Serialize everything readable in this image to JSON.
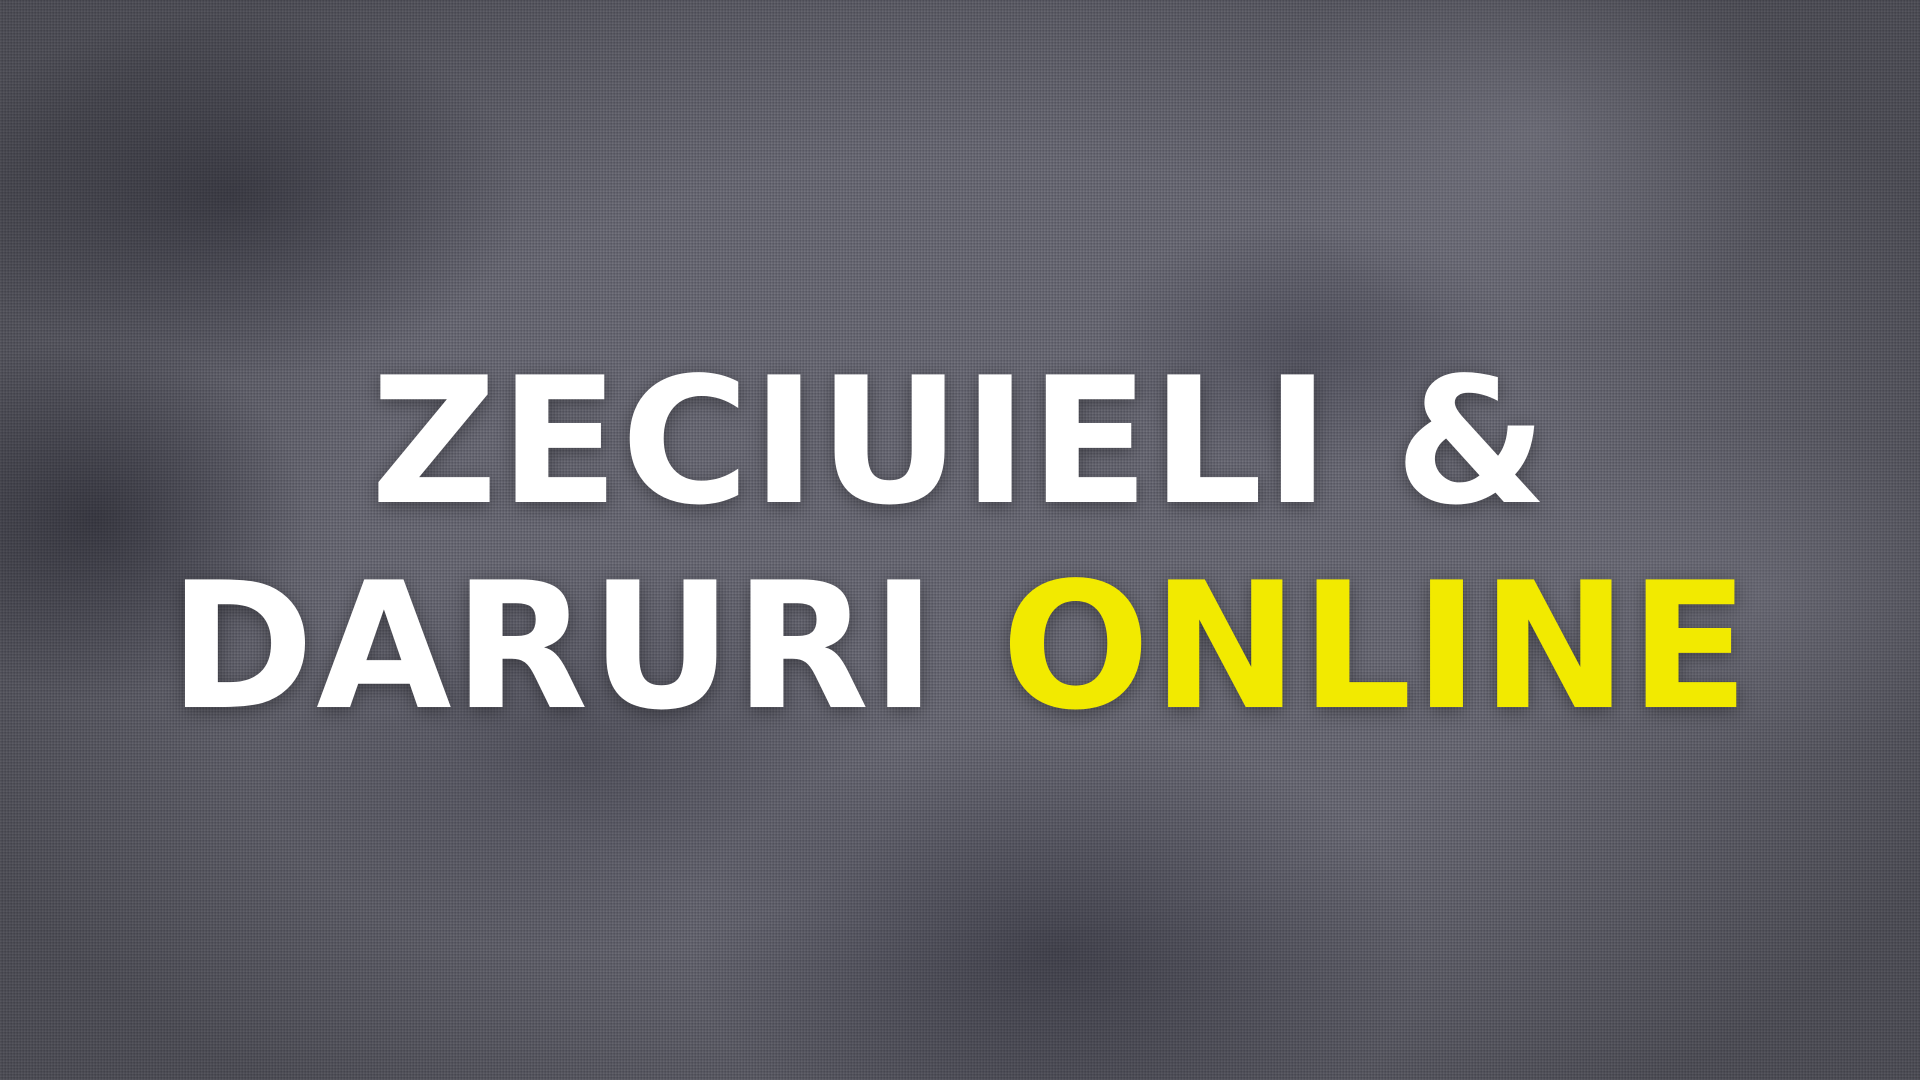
{
  "title": {
    "line1": "ZECIUIELI &",
    "line2_white": "DARURI",
    "line2_highlight": "ONLINE"
  },
  "colors": {
    "text": "#ffffff",
    "highlight": "#f2ea00",
    "background": "#62626e"
  }
}
